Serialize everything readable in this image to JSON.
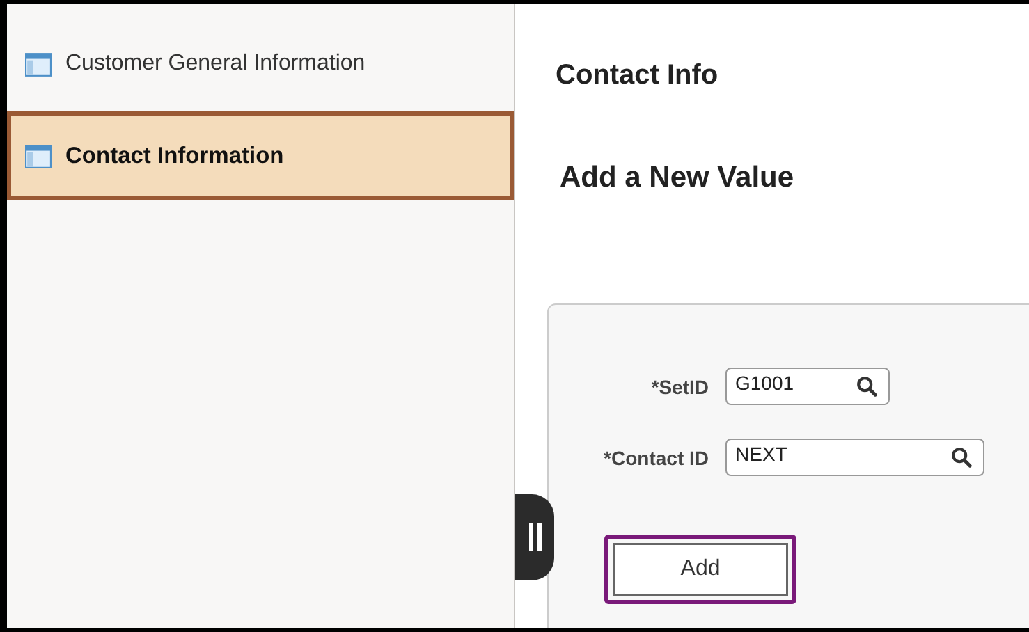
{
  "sidebar": {
    "items": [
      {
        "label": "Customer General Information",
        "selected": false
      },
      {
        "label": "Contact Information",
        "selected": true
      }
    ]
  },
  "page_title": "Contact Info",
  "heading": "Add a New Value",
  "form": {
    "fields": [
      {
        "label": "*SetID",
        "value": "G1001"
      },
      {
        "label": "*Contact ID",
        "value": "NEXT"
      }
    ],
    "button": {
      "label": "Add",
      "focused": true
    }
  }
}
